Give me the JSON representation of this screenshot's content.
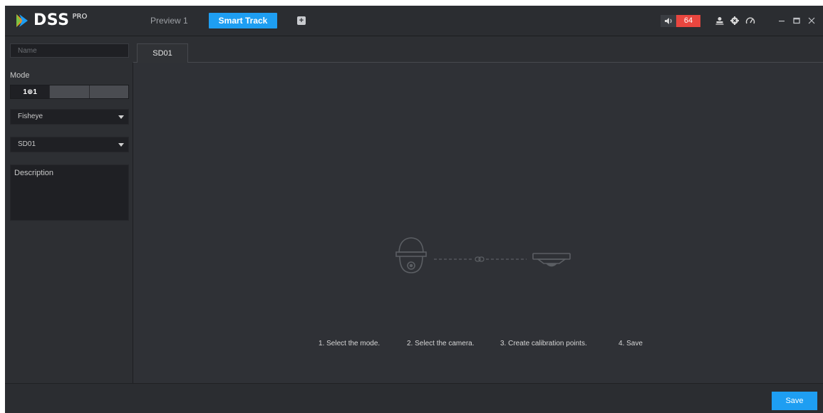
{
  "window": {
    "logo_text": "DSS",
    "logo_sup": "PRO",
    "tabs": [
      {
        "label": "Preview 1"
      },
      {
        "label": "Smart Track"
      }
    ],
    "add_tab_icon": "plus-square-icon",
    "alarm_count": "64",
    "icons": [
      "volume-icon",
      "user-icon",
      "gear-icon",
      "speedometer-icon",
      "minimize-icon",
      "maximize-icon",
      "close-icon"
    ],
    "accent_color": "#1e9ef2",
    "alarm_color": "#e9463f"
  },
  "left_panel": {
    "name_placeholder": "Name",
    "mode_label": "Mode",
    "mode_options": [
      "1⊕1",
      "",
      ""
    ],
    "camera_type_select": "Fisheye",
    "camera_select": "SD01",
    "description_placeholder": "Description"
  },
  "main": {
    "active_tab": "SD01",
    "illustration": [
      "speed-dome-camera-icon",
      "link-icon",
      "fisheye-camera-icon"
    ],
    "steps": [
      "1. Select the mode.",
      "2. Select the camera.",
      "3. Create calibration points.",
      "4. Save"
    ]
  },
  "footer": {
    "save_label": "Save"
  }
}
